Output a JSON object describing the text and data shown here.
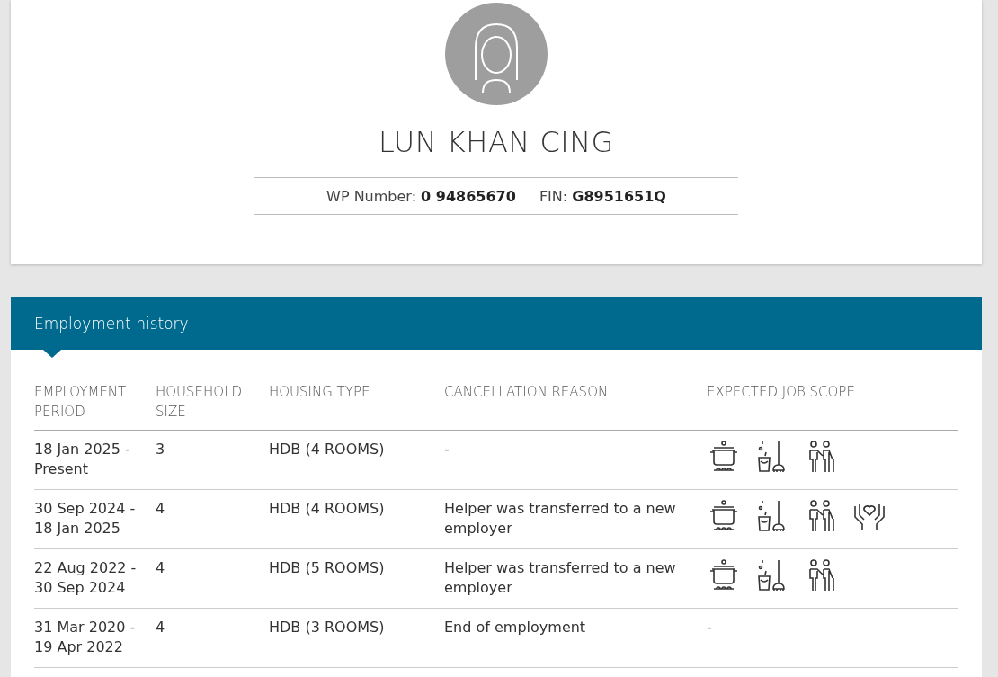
{
  "profile": {
    "name": "LUN KHAN CING",
    "wp_label": "WP Number:",
    "wp_number": "0 94865670",
    "fin_label": "FIN:",
    "fin": "G8951651Q"
  },
  "employment_history": {
    "title": "Employment history",
    "columns": [
      "EMPLOYMENT PERIOD",
      "HOUSEHOLD SIZE",
      "HOUSING TYPE",
      "CANCELLATION REASON",
      "EXPECTED JOB SCOPE"
    ],
    "rows": [
      {
        "period": "18 Jan 2025 - Present",
        "household_size": "3",
        "housing_type": "HDB (4 ROOMS)",
        "cancellation_reason": "-",
        "job_scope": [
          {
            "kind": "cooking"
          },
          {
            "kind": "cleaning"
          },
          {
            "kind": "elderly"
          }
        ]
      },
      {
        "period": "30 Sep 2024 - 18 Jan 2025",
        "household_size": "4",
        "housing_type": "HDB (4 ROOMS)",
        "cancellation_reason": "Helper was transferred to a new employer",
        "job_scope": [
          {
            "kind": "cooking"
          },
          {
            "kind": "cleaning"
          },
          {
            "kind": "elderly"
          },
          {
            "kind": "care"
          }
        ]
      },
      {
        "period": "22 Aug 2022 - 30 Sep 2024",
        "household_size": "4",
        "housing_type": "HDB (5 ROOMS)",
        "cancellation_reason": "Helper was transferred to a new employer",
        "job_scope": [
          {
            "kind": "cooking"
          },
          {
            "kind": "cleaning"
          },
          {
            "kind": "elderly"
          }
        ]
      },
      {
        "period": "31 Mar 2020 - 19 Apr 2022",
        "household_size": "4",
        "housing_type": "HDB (3 ROOMS)",
        "cancellation_reason": "End of employment",
        "job_scope_text": "-"
      }
    ]
  }
}
